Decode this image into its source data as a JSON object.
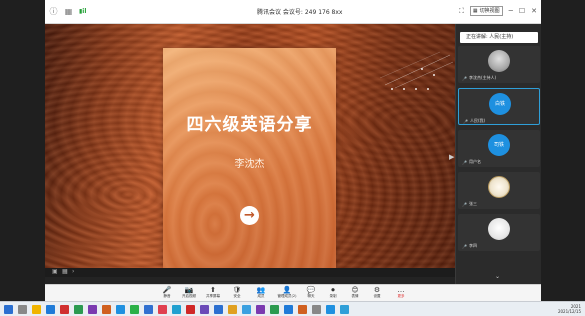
{
  "window": {
    "title": "腾讯会议 会议号: 249 176 8xx",
    "view_label": "切换视图"
  },
  "slide": {
    "title": "四六级英语分享",
    "author": "李沈杰",
    "arrow": "→"
  },
  "panel": {
    "header": "正在讲解: 人民(主持)",
    "participants": [
      {
        "avatar": "photo",
        "avatar_text": "",
        "name": "李沈杰(主持人)"
      },
      {
        "avatar": "blue",
        "avatar_text": "白铁",
        "name": "人民(我)"
      },
      {
        "avatar": "blue",
        "avatar_text": "司铁",
        "name": "用户名"
      },
      {
        "avatar": "seal",
        "avatar_text": "",
        "name": "张三"
      },
      {
        "avatar": "white",
        "avatar_text": "",
        "name": "李四"
      }
    ]
  },
  "stage_bar": {
    "left_icons": [
      "chat-icon",
      "grid-icon"
    ]
  },
  "toolbar": {
    "items": [
      {
        "icon": "🎤",
        "label": "静音"
      },
      {
        "icon": "📷",
        "label": "开启视频"
      },
      {
        "icon": "⬆",
        "label": "共享屏幕"
      },
      {
        "icon": "🛡",
        "label": "安全"
      },
      {
        "icon": "👥",
        "label": "成员"
      },
      {
        "icon": "👤",
        "label": "管理成员(2)"
      },
      {
        "icon": "💬",
        "label": "聊天"
      },
      {
        "icon": "⏺",
        "label": "录制"
      },
      {
        "icon": "😊",
        "label": "表情"
      },
      {
        "icon": "⚙",
        "label": "设置"
      },
      {
        "icon": "…",
        "label": "更多"
      }
    ]
  },
  "taskbar": {
    "time": "2021",
    "date": "2021/12/15"
  },
  "colors": {
    "accent": "#2f9fd8",
    "avatar_blue": "#1e90e0",
    "canyon_orange": "#c0582a"
  }
}
